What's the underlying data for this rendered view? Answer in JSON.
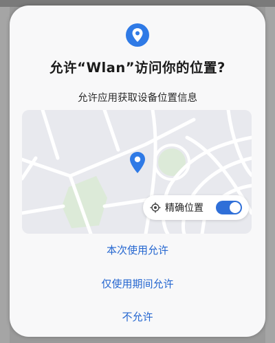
{
  "dialog": {
    "icon": "location-pin-icon",
    "title": "允许“Wlan”访问你的位置?",
    "subtitle": "允许应用获取设备位置信息",
    "precise_location": {
      "label": "精确位置",
      "enabled": true,
      "icon": "crosshair-icon"
    },
    "actions": [
      {
        "label": "本次使用允许"
      },
      {
        "label": "仅使用期间允许"
      },
      {
        "label": "不允许"
      }
    ]
  },
  "colors": {
    "accent": "#2f7ae6",
    "action_text": "#2466d0",
    "toggle_on": "#2f6fd8",
    "dialog_bg": "#f8f8f9",
    "map_bg": "#e8e9ee",
    "map_park": "#dcead8"
  }
}
